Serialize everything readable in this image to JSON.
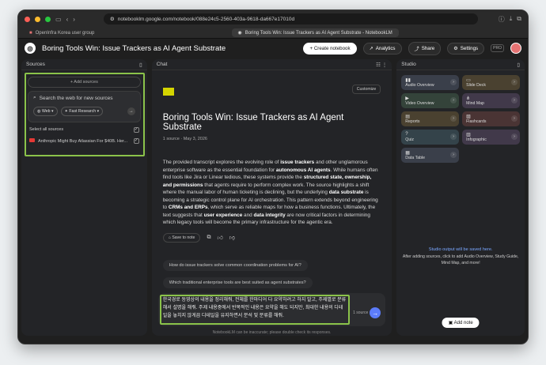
{
  "browser": {
    "url": "notebooklm.google.com/notebook/088e24c5-2560-403a-9618-da667e17010d",
    "tab_1": "OpenInfra Korea user group",
    "tab_2": "Boring Tools Win: Issue Trackers as AI Agent Substrate - NotebookLM"
  },
  "header": {
    "title": "Boring Tools Win: Issue Trackers as AI Agent Substrate",
    "create_label": "+ Create notebook",
    "analytics_label": "Analytics",
    "share_label": "Share",
    "settings_label": "Settings",
    "pro_label": "PRO"
  },
  "sources": {
    "title": "Sources",
    "add_label": "+ Add sources",
    "search_placeholder": "Search the web for new sources",
    "web_label": "Web",
    "research_label": "Fast Research",
    "select_all": "Select all sources",
    "item": "Anthropic Might Buy Atlassian For $40B. Her..."
  },
  "chat": {
    "title": "Chat",
    "customize": "Customize",
    "heading": "Boring Tools Win: Issue Trackers as AI Agent Substrate",
    "meta": "1 source · May 3, 2026",
    "s1": "The provided transcript explores the evolving role of ",
    "s1b": "issue trackers",
    "s2": " and other unglamorous enterprise software as the essential foundation for ",
    "s2b": "autonomous AI agents",
    "s3": ". While humans often find tools like Jira or Linear tedious, these systems provide the ",
    "s3b": "structured state, ownership, and permissions",
    "s4": " that agents require to perform complex work. The source highlights a shift where the manual labor of human ticketing is declining, but the underlying ",
    "s4b": "data substrate",
    "s5": " is becoming a strategic control plane for AI orchestration. This pattern extends beyond engineering to ",
    "s5b": "CRMs and ERPs",
    "s6": ", which serve as reliable maps for how a business functions. Ultimately, the text suggests that ",
    "s6b": "user experience",
    "s7": " and ",
    "s7b": "data integrity",
    "s8": " are now critical factors in determining which legacy tools will become the primary infrastructure for the agentic era.",
    "save_note": "Save to note",
    "q1": "How do issue trackers solve common coordination problems for AI?",
    "q2": "Which traditional enterprise tools are best suited as agent substrates?",
    "input": "한국경로 동영상의 내용을 정리해줘, 전체를 한마디어 다 요약하려고 하지 말고, 주제별로 분류해서 설명을 해줘. 주제 내용중에서 반복적인 내용은 요약을 해도 되지만, 최대한 내용의 디테일을 놓치지 않게끔 디테일을 유지하면서 분석 및 분류를 해줘.",
    "source_count": "1 source",
    "footer": "NotebookLM can be inaccurate; please double check its responses."
  },
  "studio": {
    "title": "Studio",
    "cards": [
      "Audio Overview",
      "Slide Deck",
      "Video Overview",
      "Mind Map",
      "Reports",
      "Flashcards",
      "Quiz",
      "Infographic",
      "Data Table"
    ],
    "msg1": "Studio output will be saved here.",
    "msg2": "After adding sources, click to add Audio Overview, Study Guide, Mind Map, and more!",
    "add_note": "Add note"
  }
}
